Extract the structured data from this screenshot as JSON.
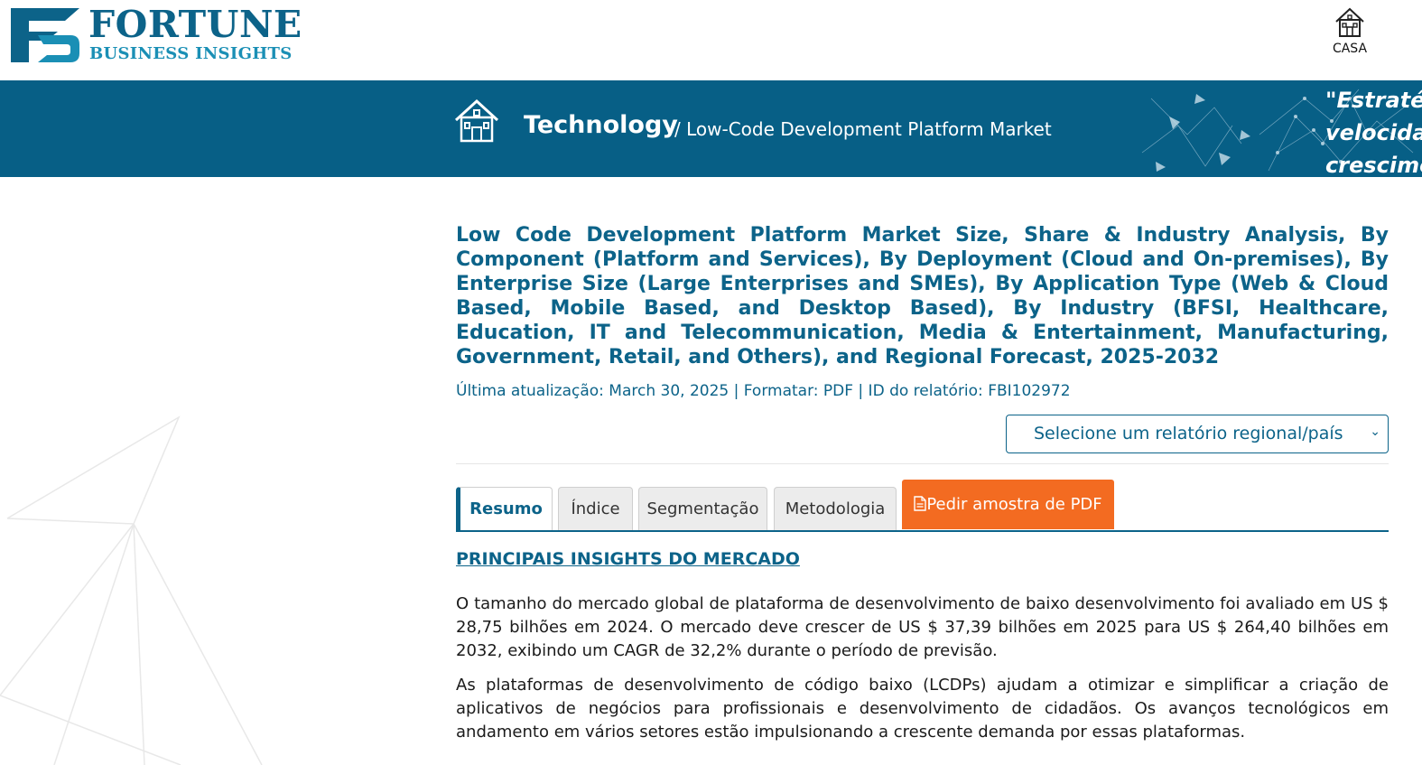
{
  "header": {
    "logo_title": "FORTUNE",
    "logo_subtitle": "BUSINESS INSIGHTS",
    "home_label": "CASA",
    "home_icon": "house-icon"
  },
  "banner": {
    "category": "Technology",
    "breadcrumb": "/ Low-Code Development Platform Market",
    "quote_lines": [
      "\"Estratég",
      "velocida",
      "crescime"
    ],
    "home_icon": "house-icon"
  },
  "report": {
    "title": "Low Code Development Platform Market Size, Share & Industry Analysis, By Component (Platform and Services), By Deployment (Cloud and On-premises), By Enterprise Size (Large Enterprises and SMEs), By Application Type (Web & Cloud Based, Mobile Based, and Desktop Based), By Industry (BFSI, Healthcare, Education, IT and Telecommunication, Media & Entertainment, Manufacturing, Government, Retail, and Others), and Regional Forecast, 2025-2032",
    "meta": "Última atualização: March 30, 2025 | Formatar: PDF | ID do relatório: FBI102972",
    "region_select_value": "Selecione um relatório regional/país"
  },
  "tabs": [
    {
      "label": "Resumo",
      "active": true
    },
    {
      "label": "Índice",
      "active": false
    },
    {
      "label": "Segmentação",
      "active": false
    },
    {
      "label": "Metodologia",
      "active": false
    }
  ],
  "sample_button": {
    "label": "Pedir amostra de PDF",
    "icon": "document-icon"
  },
  "content": {
    "section_heading": "PRINCIPAIS INSIGHTS DO MERCADO",
    "paragraphs": [
      "O tamanho do mercado global de plataforma de desenvolvimento de baixo desenvolvimento foi avaliado em US $ 28,75 bilhões em 2024. O mercado deve crescer de US $ 37,39 bilhões em 2025 para US $ 264,40 bilhões em 2032, exibindo um CAGR de 32,2% durante o período de previsão.",
      "As plataformas de desenvolvimento de código baixo (LCDPs) ajudam a otimizar e simplificar a criação de aplicativos de negócios para profissionais e desenvolvimento de cidadãos. Os avanços tecnológicos em andamento em vários setores estão impulsionando a crescente demanda por essas plataformas."
    ]
  },
  "colors": {
    "brand": "#0c6389",
    "banner": "#075f86",
    "accent": "#f36b21"
  }
}
